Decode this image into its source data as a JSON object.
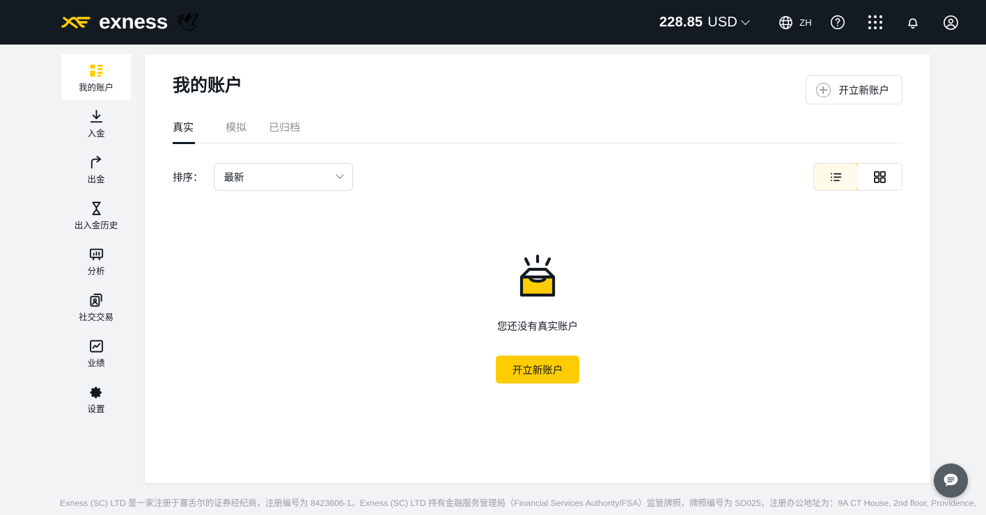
{
  "topbar": {
    "logo_text": "exness",
    "logo_mark": "exness-logo-icon",
    "dove": "🕊",
    "balance_amount": "228.85",
    "balance_currency": "USD",
    "lang_code": "ZH",
    "icons": {
      "globe": "globe-icon",
      "help": "help-circle-icon",
      "apps": "apps-grid-icon",
      "bell": "notifications-bell-icon",
      "account": "user-account-icon"
    }
  },
  "sidebar": {
    "items": [
      {
        "label": "我的账户",
        "icon": "dashboard-icon",
        "active": true
      },
      {
        "label": "入金",
        "icon": "deposit-download-icon",
        "active": false
      },
      {
        "label": "出金",
        "icon": "withdraw-upload-icon",
        "active": false
      },
      {
        "label": "出入金历史",
        "icon": "hourglass-history-icon",
        "active": false
      },
      {
        "label": "分析",
        "icon": "analytics-board-icon",
        "active": false
      },
      {
        "label": "社交交易",
        "icon": "social-trading-icon",
        "active": false
      },
      {
        "label": "业绩",
        "icon": "performance-chart-icon",
        "active": false
      },
      {
        "label": "设置",
        "icon": "gear-settings-icon",
        "active": false
      }
    ]
  },
  "main": {
    "title": "我的账户",
    "new_account_top_label": "开立新账户",
    "tabs": [
      {
        "label": "真实",
        "active": true
      },
      {
        "label": "模拟",
        "active": false
      },
      {
        "label": "已归档",
        "active": false
      }
    ],
    "sort_label": "排序：",
    "sort_value": "最新",
    "view_list_icon": "list-view-icon",
    "view_grid_icon": "grid-view-icon",
    "empty": {
      "icon": "empty-box-icon",
      "text": "您还没有真实账户",
      "cta_label": "开立新账户"
    }
  },
  "footer": {
    "text": "Exness (SC) LTD 是一家注册于塞舌尔的证券经纪商，注册编号为 8423606-1。Exness (SC) LTD 持有金融服务管理局（Financial Services Authority/FSA）监管牌照，牌照编号为 SD025，注册办公地址为：9A CT House, 2nd floor, Providence,"
  },
  "chat": {
    "icon": "chat-bubble-icon"
  },
  "colors": {
    "brand_yellow": "#ffcc00",
    "header_dark": "#131a21",
    "page_bg": "#f2f3f5",
    "muted_text": "#8b8f96"
  }
}
